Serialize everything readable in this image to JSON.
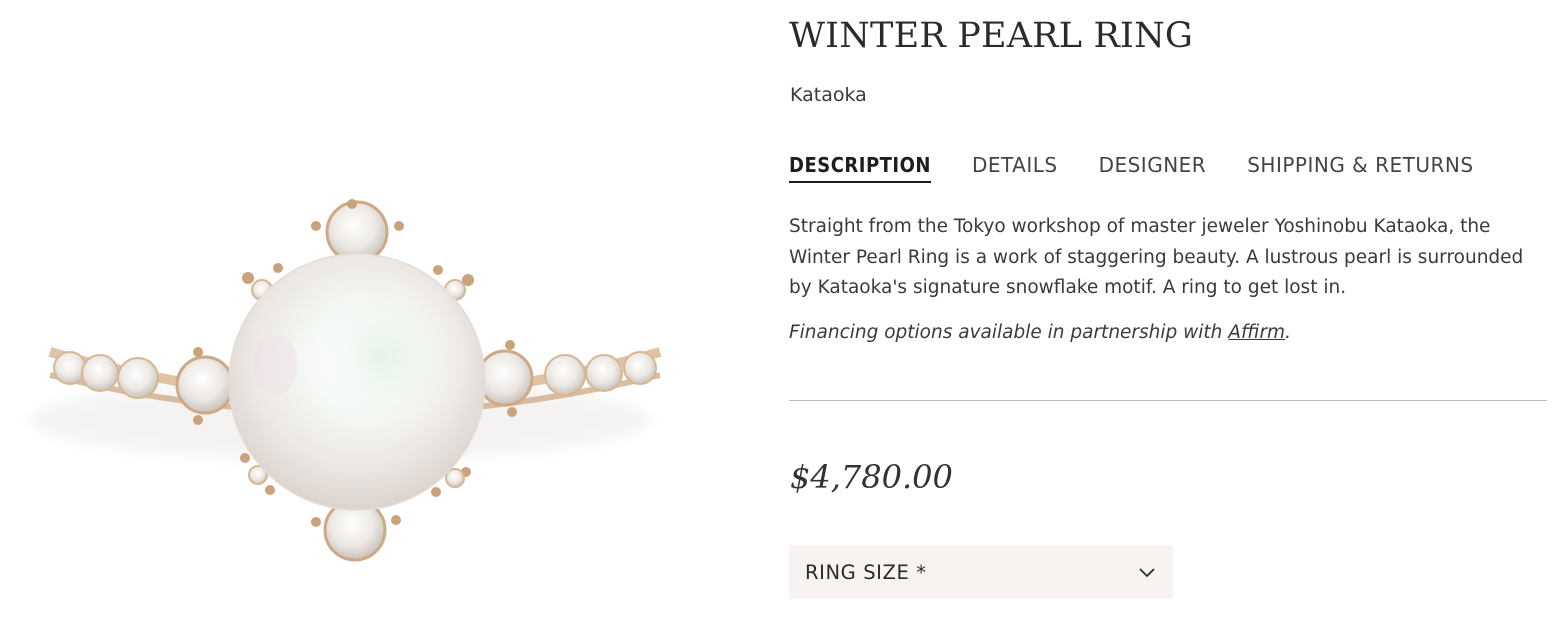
{
  "product": {
    "title": "WINTER PEARL RING",
    "designer": "Kataoka",
    "image_alt": "Winter Pearl Ring"
  },
  "tabs": [
    {
      "label": "DESCRIPTION",
      "active": true
    },
    {
      "label": "DETAILS",
      "active": false
    },
    {
      "label": "DESIGNER",
      "active": false
    },
    {
      "label": "SHIPPING & RETURNS",
      "active": false
    }
  ],
  "description": {
    "body": "Straight from the Tokyo workshop of master jeweler Yoshinobu Kataoka, the Winter Pearl Ring is a work of staggering beauty. A lustrous pearl is surrounded by Kataoka's signature snowflake motif. A ring to get lost in.",
    "financing_prefix": "Financing options available in partnership with ",
    "financing_link": "Affirm",
    "financing_suffix": "."
  },
  "price": "$4,780.00",
  "size_select": {
    "label": "RING SIZE *",
    "icon": "chevron-down-icon"
  },
  "colors": {
    "select_background": "#f8f3f1",
    "divider": "#bdbdbd",
    "text": "#2a2a2a",
    "gold": "#c9a37a"
  }
}
